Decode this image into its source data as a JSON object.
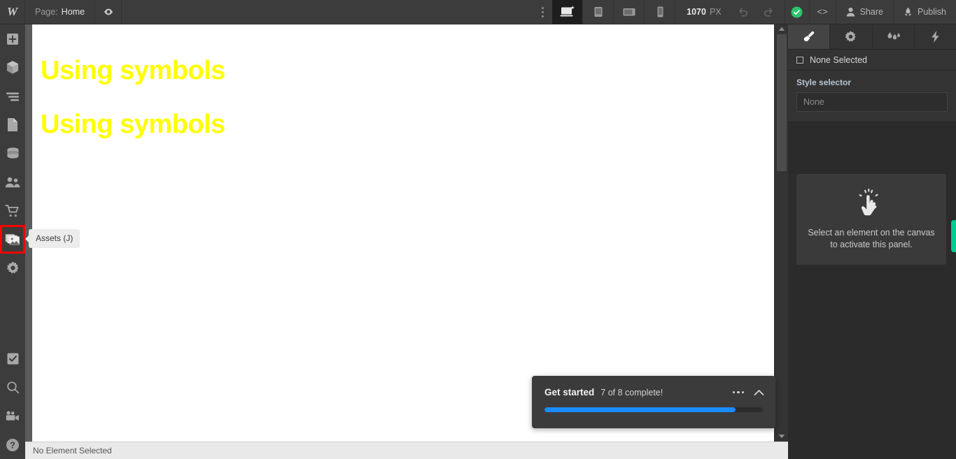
{
  "topbar": {
    "logo": "W",
    "page_label": "Page:",
    "page_name": "Home",
    "preview_icon": "eye-icon",
    "more_icon": "vertical-dots-icon",
    "breakpoints": [
      {
        "name": "desktop",
        "icon": "desktop-icon",
        "active": true
      },
      {
        "name": "tablet",
        "icon": "tablet-icon",
        "active": false
      },
      {
        "name": "tablet-landscape",
        "icon": "tablet-landscape-icon",
        "active": false
      },
      {
        "name": "mobile",
        "icon": "mobile-icon",
        "active": false
      }
    ],
    "viewport_width": "1070",
    "viewport_unit": "PX",
    "undo_icon": "undo-icon",
    "redo_icon": "redo-icon",
    "save_status_icon": "check-circle-icon",
    "code_label": "<>",
    "share_label": "Share",
    "publish_label": "Publish"
  },
  "sidebar": {
    "items": [
      {
        "name": "add-elements",
        "icon": "plus-icon",
        "selected": false
      },
      {
        "name": "components",
        "icon": "cube-icon",
        "selected": false
      },
      {
        "name": "navigator",
        "icon": "navigator-icon",
        "selected": false
      },
      {
        "name": "pages",
        "icon": "page-icon",
        "selected": false
      },
      {
        "name": "cms",
        "icon": "database-icon",
        "selected": false
      },
      {
        "name": "users",
        "icon": "users-icon",
        "selected": false
      },
      {
        "name": "ecommerce",
        "icon": "cart-icon",
        "selected": false
      },
      {
        "name": "assets",
        "icon": "assets-icon",
        "selected": true
      },
      {
        "name": "settings",
        "icon": "gear-icon",
        "selected": false
      }
    ],
    "bottom_items": [
      {
        "name": "audit",
        "icon": "check-square-icon"
      },
      {
        "name": "search",
        "icon": "search-icon"
      },
      {
        "name": "videos",
        "icon": "video-camera-icon"
      },
      {
        "name": "help",
        "icon": "question-circle-icon"
      }
    ],
    "tooltip": "Assets (J)",
    "selection_outline_color": "#ff0000"
  },
  "canvas": {
    "headings": [
      {
        "text": "Using symbols"
      },
      {
        "text": "Using symbols"
      }
    ],
    "heading_color": "#ffff00",
    "background": "#ffffff"
  },
  "get_started": {
    "title": "Get started",
    "subtitle": "7 of 8 complete!",
    "more_icon": "horizontal-dots-icon",
    "collapse_icon": "chevron-up-icon",
    "progress_percent": 87.5,
    "progress_color": "#1a8cff"
  },
  "right_panel": {
    "tabs": [
      {
        "name": "style",
        "icon": "paintbrush-icon",
        "active": true
      },
      {
        "name": "settings",
        "icon": "gear-icon",
        "active": false
      },
      {
        "name": "interactions",
        "icon": "water-drops-icon",
        "active": false
      },
      {
        "name": "effects",
        "icon": "lightning-bolt-icon",
        "active": false
      }
    ],
    "selection_label": "None Selected",
    "style_selector_label": "Style selector",
    "style_selector_value": "None",
    "empty_state": {
      "icon": "click-hand-icon",
      "line1": "Select an element on the canvas",
      "line2": "to activate this panel."
    },
    "green_tab_color": "#00cc96"
  },
  "status_bar": {
    "text": "No Element Selected"
  }
}
